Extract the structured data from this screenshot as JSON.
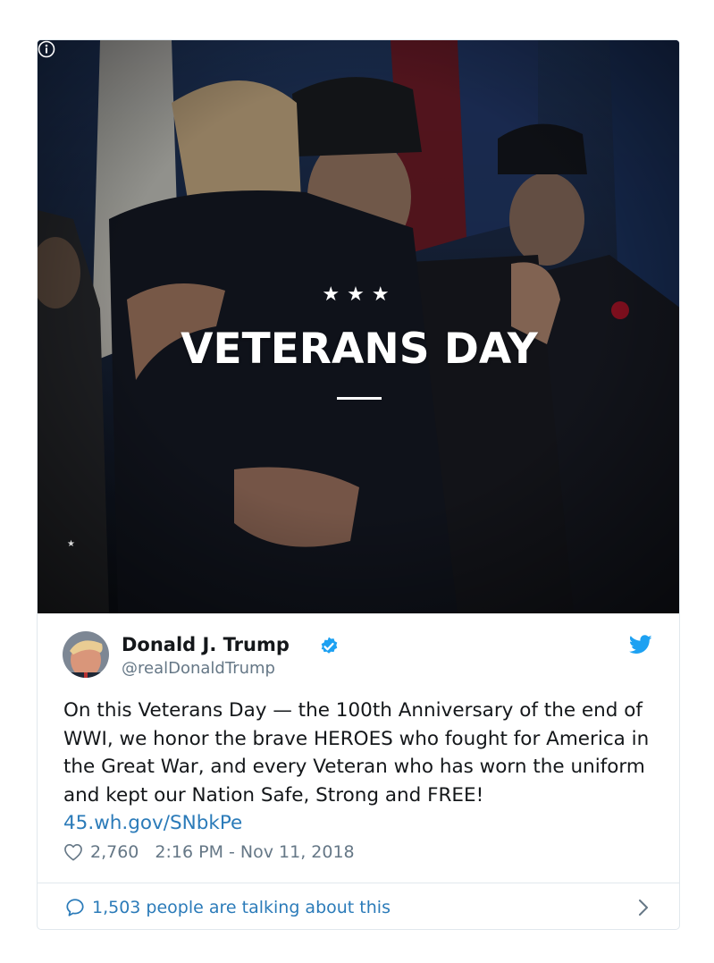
{
  "media": {
    "stars": "★★★",
    "headline": "VETERANS DAY",
    "info_icon": "info-circle-icon",
    "corner_star": "★"
  },
  "author": {
    "name": "Donald J. Trump",
    "handle": "@realDonaldTrump",
    "verified_icon": "verified-badge-icon",
    "avatar_icon": "avatar"
  },
  "tweet": {
    "text": "On this Veterans Day — the 100th Anniversary of the end of WWI, we honor the brave HEROES who fought for America in the Great War, and every Veteran who has worn the uniform and kept our Nation Safe, Strong and FREE!",
    "link": "45.wh.gov/SNbkPe"
  },
  "meta": {
    "likes": "2,760",
    "timestamp": "2:16 PM - Nov 11, 2018"
  },
  "footer": {
    "talking": "1,503 people are talking about this"
  },
  "colors": {
    "link": "#2b7bb9",
    "twitter_blue": "#1da1f2",
    "text": "#14171a",
    "secondary": "#657786",
    "border": "#e1e8ed"
  }
}
